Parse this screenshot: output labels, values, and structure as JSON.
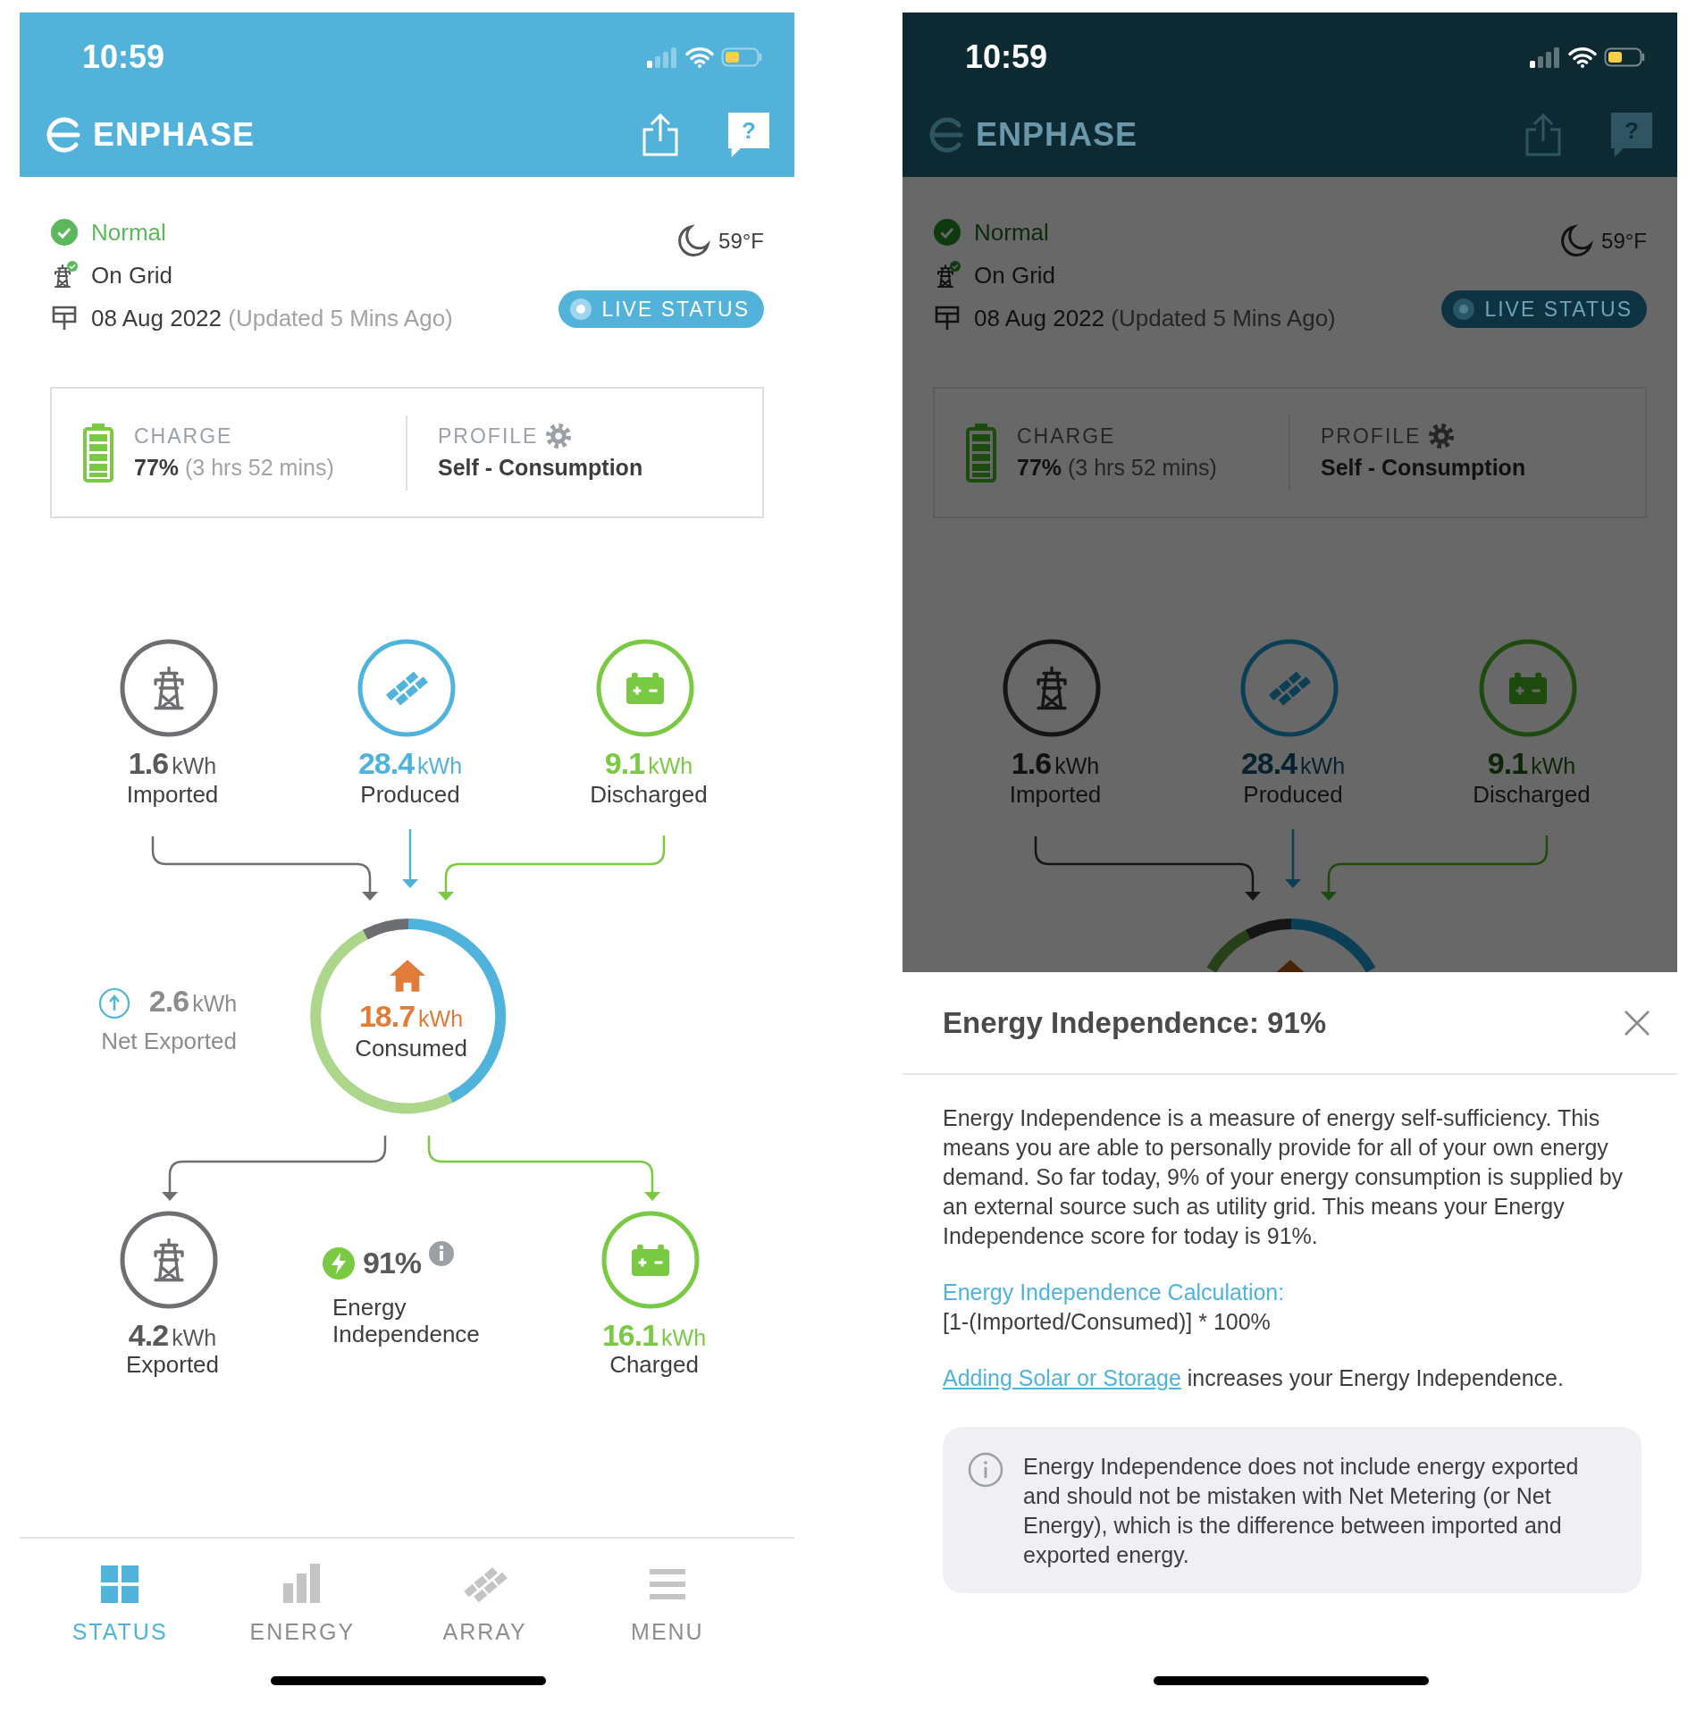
{
  "screens": [
    {
      "dimmed": false,
      "status_bar": {
        "time": "10:59"
      },
      "header": {
        "brand": "ENPHASE",
        "help_glyph": "?"
      },
      "system": {
        "status": "Normal",
        "grid": "On Grid",
        "date": "08 Aug 2022",
        "updated": "(Updated 5 Mins Ago)",
        "temperature": "59°F",
        "live_button": "LIVE STATUS"
      },
      "battery_card": {
        "charge_label": "CHARGE",
        "charge_value": "77%",
        "charge_time": "(3 hrs 52 mins)",
        "profile_label": "PROFILE",
        "profile_value": "Self - Consumption"
      },
      "sources": [
        {
          "kind": "grid",
          "value": "1.6",
          "unit": "kWh",
          "label": "Imported"
        },
        {
          "kind": "solar",
          "value": "28.4",
          "unit": "kWh",
          "label": "Produced"
        },
        {
          "kind": "battery",
          "value": "9.1",
          "unit": "kWh",
          "label": "Discharged"
        }
      ],
      "consumption": {
        "value": "18.7",
        "unit": "kWh",
        "label": "Consumed"
      },
      "net": {
        "value": "2.6",
        "unit": "kWh",
        "label": "Net Exported"
      },
      "sinks": [
        {
          "kind": "grid",
          "value": "4.2",
          "unit": "kWh",
          "label": "Exported"
        },
        {
          "kind": "battery",
          "value": "16.1",
          "unit": "kWh",
          "label": "Charged"
        }
      ],
      "independence": {
        "value": "91%",
        "label": "Energy Independence"
      },
      "tabs": [
        {
          "kind": "status",
          "label": "STATUS",
          "selected": true
        },
        {
          "kind": "energy",
          "label": "ENERGY",
          "selected": false
        },
        {
          "kind": "array",
          "label": "ARRAY",
          "selected": false
        },
        {
          "kind": "menu",
          "label": "MENU",
          "selected": false
        }
      ]
    },
    {
      "dimmed": true,
      "status_bar": {
        "time": "10:59"
      },
      "header": {
        "brand": "ENPHASE",
        "help_glyph": "?"
      },
      "system": {
        "status": "Normal",
        "grid": "On Grid",
        "date": "08 Aug 2022",
        "updated": "(Updated 5 Mins Ago)",
        "temperature": "59°F",
        "live_button": "LIVE STATUS"
      },
      "battery_card": {
        "charge_label": "CHARGE",
        "charge_value": "77%",
        "charge_time": "(3 hrs 52 mins)",
        "profile_label": "PROFILE",
        "profile_value": "Self - Consumption"
      },
      "sources": [
        {
          "kind": "grid",
          "value": "1.6",
          "unit": "kWh",
          "label": "Imported"
        },
        {
          "kind": "solar",
          "value": "28.4",
          "unit": "kWh",
          "label": "Produced"
        },
        {
          "kind": "battery",
          "value": "9.1",
          "unit": "kWh",
          "label": "Discharged"
        }
      ]
    }
  ],
  "sheet": {
    "title": "Energy Independence: 91%",
    "description": "Energy Independence is a measure of energy self-sufficiency. This means you are able to personally provide for all of your own energy demand. So far today, 9% of your energy consumption is supplied by an external source such as utility grid. This means your Energy Independence score for today is 91%.",
    "calculation_title": "Energy Independence Calculation:",
    "formula": "[1-(Imported/Consumed)] * 100%",
    "link": "Adding Solar or Storage",
    "link_suffix": "increases your Energy Independence.",
    "note": "Energy Independence does not include energy exported and should not be mistaken with Net Metering (or Net Energy), which is the difference between imported and exported energy."
  }
}
